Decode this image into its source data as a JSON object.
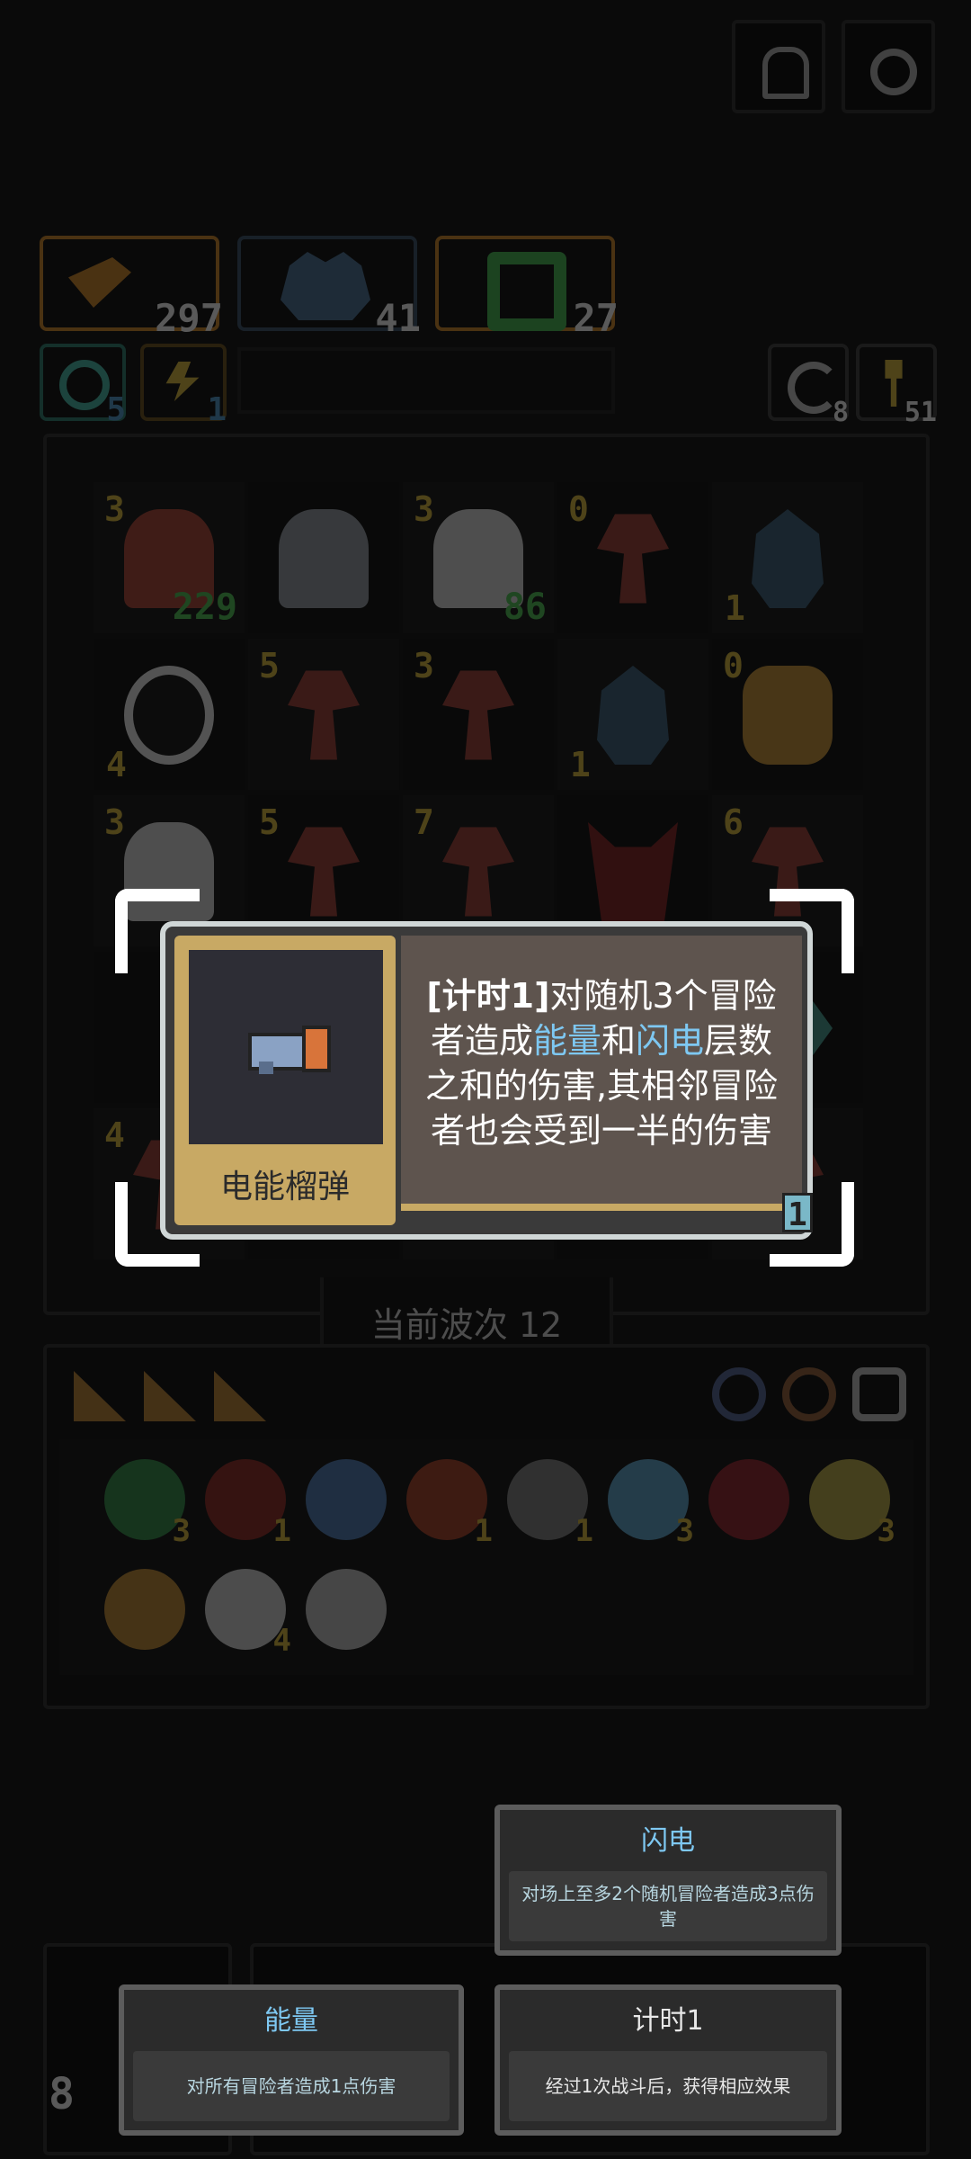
{
  "top_buttons": [
    {
      "icon": "help-icon"
    },
    {
      "icon": "settings-icon"
    }
  ],
  "stats": [
    {
      "icon": "attack-icon",
      "value": "297",
      "color": "#e48c1c"
    },
    {
      "icon": "monster-icon",
      "value": "41",
      "color": "#3f5d7a"
    },
    {
      "icon": "ring-icon",
      "value": "27",
      "color": "#e48c1c"
    }
  ],
  "sub_stats": [
    {
      "icon": "target-icon",
      "value": "5"
    },
    {
      "icon": "lightning-icon",
      "value": "1"
    }
  ],
  "right_stats": [
    {
      "icon": "refresh-icon",
      "value": "8"
    },
    {
      "icon": "key-icon",
      "value": "51"
    }
  ],
  "grid": [
    [
      {
        "top": "3",
        "hp": "229",
        "type": "hero-red"
      },
      {
        "type": "hero-plain"
      },
      {
        "top": "3",
        "hp": "86",
        "type": "hero-white"
      },
      {
        "top": "0",
        "type": "mushroom"
      },
      {
        "bottom": "1",
        "type": "golem"
      }
    ],
    [
      {
        "bottom": "4",
        "type": "bomb"
      },
      {
        "top": "5",
        "type": "mushroom"
      },
      {
        "top": "3",
        "type": "mushroom"
      },
      {
        "bottom": "1",
        "type": "golem"
      },
      {
        "top": "0",
        "type": "coin"
      }
    ],
    [
      {
        "top": "3",
        "type": "hero-white"
      },
      {
        "top": "5",
        "type": "mushroom"
      },
      {
        "top": "7",
        "type": "mushroom"
      },
      {
        "type": "demon"
      },
      {
        "top": "6",
        "type": "mushroom"
      }
    ],
    [
      {
        "type": "empty"
      },
      {
        "type": "empty"
      },
      {
        "type": "empty"
      },
      {
        "type": "empty"
      },
      {
        "type": "dragon"
      }
    ],
    [
      {
        "top": "4",
        "type": "mushroom"
      },
      {
        "type": "empty"
      },
      {
        "type": "empty"
      },
      {
        "type": "empty"
      },
      {
        "type": "mushroom"
      }
    ]
  ],
  "wave_label": "当前波次 12",
  "relics": [
    {
      "icon": "gem-icon",
      "count": "3",
      "color": "#2e9a4a"
    },
    {
      "icon": "apple-icon",
      "count": "1",
      "color": "#a9322a"
    },
    {
      "icon": "snowflake-icon",
      "count": "",
      "color": "#4f86c8"
    },
    {
      "icon": "hat-icon",
      "count": "1",
      "color": "#c2472a"
    },
    {
      "icon": "sword-icon",
      "count": "1",
      "color": "#8a8a8a"
    },
    {
      "icon": "wings-icon",
      "count": "3",
      "color": "#5aaedc"
    },
    {
      "icon": "orb-icon",
      "count": "",
      "color": "#b02a34"
    },
    {
      "icon": "scroll-icon",
      "count": "3",
      "color": "#c8b43a"
    },
    {
      "icon": "bell-icon",
      "count": "",
      "color": "#d0902a"
    },
    {
      "icon": "cloud-icon",
      "count": "4",
      "color": "#d8d8d8"
    },
    {
      "icon": "dice-icon",
      "count": "",
      "color": "#c8c8c8"
    }
  ],
  "item_card": {
    "name": "电能榴弹",
    "desc_parts": [
      {
        "text": "[计时1]",
        "style": "bold"
      },
      {
        "text": "对随机3个冒险者造成",
        "style": "normal"
      },
      {
        "text": "能量",
        "style": "blue"
      },
      {
        "text": "和",
        "style": "normal"
      },
      {
        "text": "闪电",
        "style": "blue"
      },
      {
        "text": "层数之和的伤害,其相邻冒险者也会受到一半的伤害",
        "style": "normal"
      }
    ],
    "corner_count": "1",
    "colors": {
      "frame": "#c8a964",
      "panel": "#5e544e",
      "icon_bg": "#2d2d35",
      "blue": "#7ec8f2"
    }
  },
  "tooltips": {
    "lightning": {
      "title": "闪电",
      "body": "对场上至多2个随机冒险者造成3点伤害"
    },
    "energy": {
      "title": "能量",
      "body": "对所有冒险者造成1点伤害"
    },
    "timer": {
      "title": "计时1",
      "body": "经过1次战斗后，获得相应效果"
    }
  },
  "bottom_count": "8"
}
